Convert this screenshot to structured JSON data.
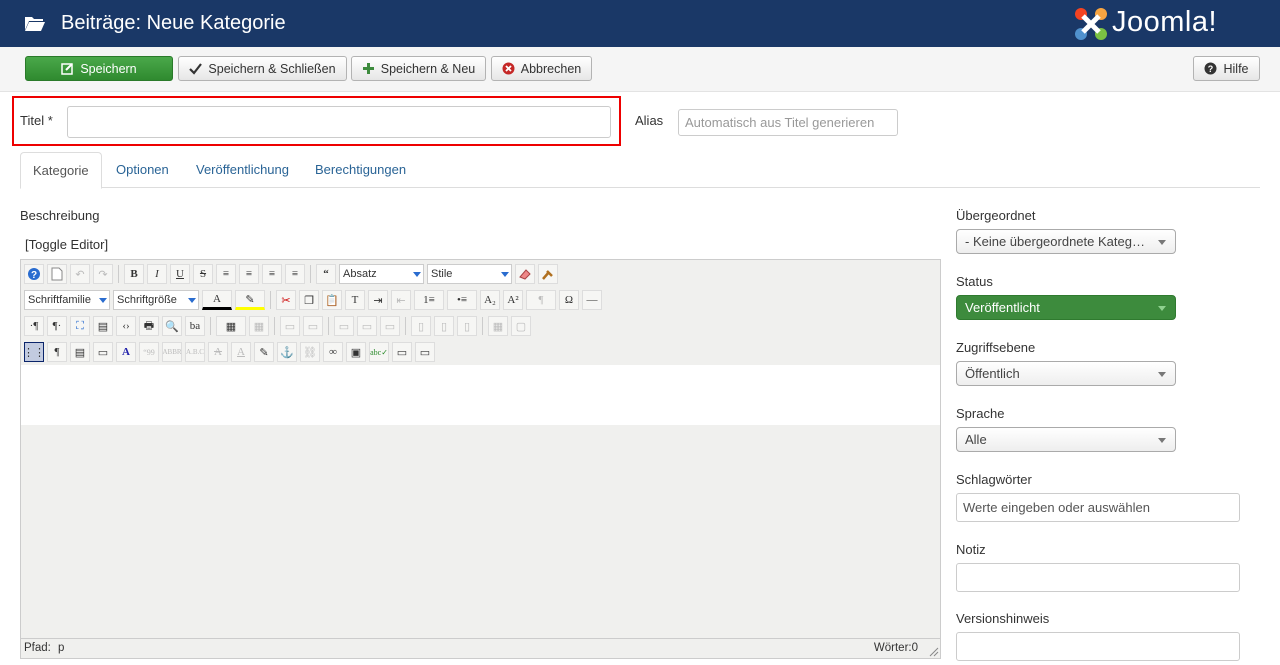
{
  "header": {
    "title": "Beiträge: Neue Kategorie",
    "logo_text": "Joomla!"
  },
  "toolbar": {
    "save_label": "Speichern",
    "save_close_label": "Speichern & Schließen",
    "save_new_label": "Speichern & Neu",
    "cancel_label": "Abbrechen",
    "help_label": "Hilfe"
  },
  "form": {
    "title_label": "Titel *",
    "title_value": "",
    "alias_label": "Alias",
    "alias_placeholder": "Automatisch aus Titel generieren"
  },
  "tabs": [
    "Kategorie",
    "Optionen",
    "Veröffentlichung",
    "Berechtigungen"
  ],
  "editor": {
    "label": "Beschreibung",
    "toggle_label": "[Toggle Editor]",
    "format_select": "Absatz",
    "style_select": "Stile",
    "font_family_select": "Schriftfamilie",
    "font_size_select": "Schriftgröße",
    "path_label": "Pfad:",
    "path_value": "p",
    "words_label": "Wörter:0"
  },
  "sidebar": {
    "parent_label": "Übergeordnet",
    "parent_value": "- Keine übergeordnete Kateg…",
    "status_label": "Status",
    "status_value": "Veröffentlicht",
    "access_label": "Zugriffsebene",
    "access_value": "Öffentlich",
    "language_label": "Sprache",
    "language_value": "Alle",
    "tags_label": "Schlagwörter",
    "tags_placeholder": "Werte eingeben oder auswählen",
    "note_label": "Notiz",
    "version_label": "Versionshinweis"
  },
  "colors": {
    "header_bg": "#1a3867",
    "success": "#3d8b3d",
    "highlight": "#ee0000"
  }
}
